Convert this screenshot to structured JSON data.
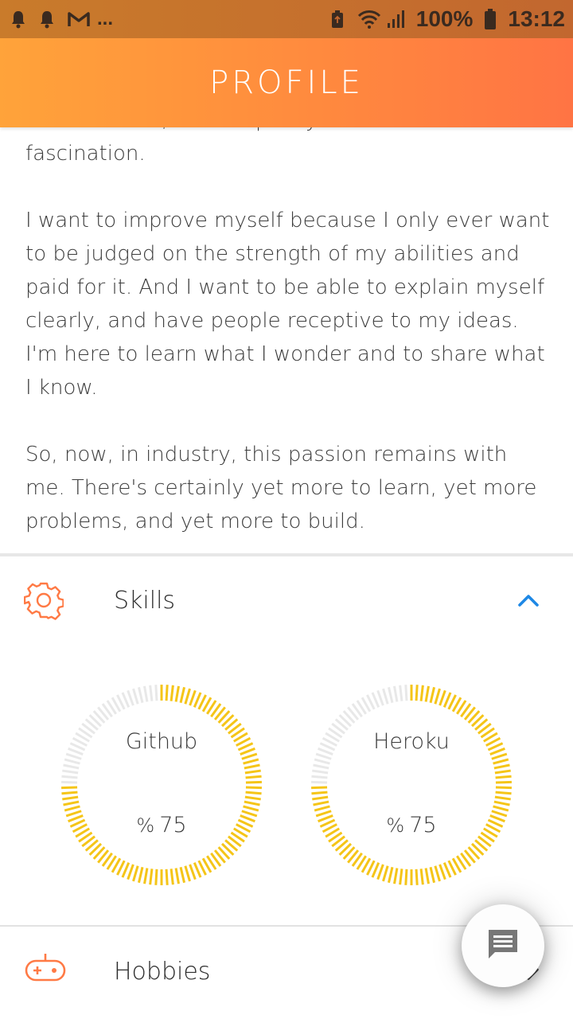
{
  "status_bar": {
    "left_icons": [
      "bell-icon",
      "bell-icon",
      "gmail-icon"
    ],
    "more": "...",
    "battery_percent": "100%",
    "time": "13:12"
  },
  "app_bar": {
    "title": "PROFILE"
  },
  "bio": {
    "paragraphs": [
      "mathematics, all with pretty much the same fascination.",
      "I want to improve myself because I only ever want to be judged on the strength of my abilities and paid for it. And I want to be able to explain myself clearly, and have people receptive to my ideas. I'm here to learn what I wonder and to share what I know.",
      "So, now, in industry, this passion remains with me. There's certainly yet more to learn, yet more problems, and yet more to build."
    ]
  },
  "skills": {
    "label": "Skills",
    "expanded": true,
    "items": [
      {
        "name": "Github",
        "percent_sign": "%",
        "value": "75",
        "fraction": 0.75
      },
      {
        "name": "Heroku",
        "percent_sign": "%",
        "value": "75",
        "fraction": 0.75
      }
    ]
  },
  "hobbies": {
    "label": "Hobbies",
    "expanded": false
  },
  "colors": {
    "accent_orange": "#ff7a45",
    "gauge_fill": "#f5c518",
    "gauge_track": "#e8e8e8",
    "chevron_blue": "#1e88e5"
  }
}
